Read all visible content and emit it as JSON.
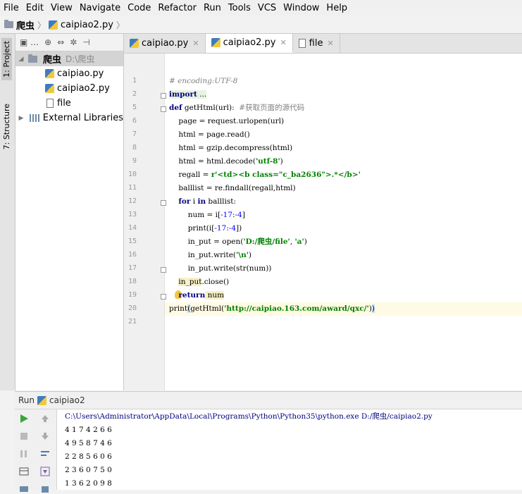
{
  "menu": [
    "File",
    "Edit",
    "View",
    "Navigate",
    "Code",
    "Refactor",
    "Run",
    "Tools",
    "VCS",
    "Window",
    "Help"
  ],
  "breadcrumb": {
    "project": "爬虫",
    "file": "caipiao2.py"
  },
  "side_tabs": {
    "project": "1: Project",
    "structure": "7: Structure"
  },
  "project_tree": {
    "root_name": "爬虫",
    "root_path": "D:\\爬虫",
    "files": [
      "caipiao.py",
      "caipiao2.py",
      "file"
    ],
    "libraries": "External Libraries"
  },
  "tabs": [
    "caipiao.py",
    "caipiao2.py",
    "file"
  ],
  "line_numbers": [
    "1",
    "2",
    "5",
    "6",
    "7",
    "8",
    "9",
    "10",
    "11",
    "12",
    "13",
    "14",
    "15",
    "16",
    "17",
    "18",
    "19",
    "20",
    "21"
  ],
  "code": {
    "l1": "# encoding:UTF-8",
    "l2_kw": "import",
    "l2_rest": " ...",
    "l5_kw": "def",
    "l5_rest": " getHtml(url):  ",
    "l5_comment": "#获取页面的源代码",
    "l6": "    page = request.urlopen(url)",
    "l7": "    html = page.read()",
    "l8": "    html = gzip.decompress(html)",
    "l9_pre": "    html = html.decode(",
    "l9_str": "'utf-8'",
    "l9_post": ")",
    "l10_pre": "    regall = ",
    "l10_str": "r'<td><b class=\"c_ba2636\">.*</b>'",
    "l11": "    balllist = re.findall(regall,html)",
    "l12_kw1": "for",
    "l12_mid": " i ",
    "l12_kw2": "in",
    "l12_rest": " balllist:",
    "l13_pre": "        num = i[",
    "l13_n1": "-17",
    "l13_mid": ":",
    "l13_n2": "-4",
    "l13_post": "]",
    "l14_pre": "        print(i[",
    "l14_n1": "-17",
    "l14_mid": ":",
    "l14_n2": "-4",
    "l14_post": "])",
    "l15_pre": "        in_put = open(",
    "l15_s1": "'D:/爬虫/file'",
    "l15_mid": ", ",
    "l15_s2": "'a'",
    "l15_post": ")",
    "l16_pre": "        in_put.write(",
    "l16_str": "'\\n'",
    "l16_post": ")",
    "l17": "        in_put.write(str(num))",
    "l18_hl": "in_put",
    "l18_rest": ".close()",
    "l19_kw": "return",
    "l19_rest": " num",
    "l20_pre": "print",
    "l20_p": "(",
    "l20_mid": "getHtml(",
    "l20_str": "'http://caipiao.163.com/award/qxc/'",
    "l20_end": ")",
    "l20_p2": ")"
  },
  "run": {
    "label": "Run",
    "config": "caipiao2",
    "command": "C:\\Users\\Administrator\\AppData\\Local\\Programs\\Python\\Python35\\python.exe D:/爬虫/caipiao2.py",
    "output": [
      "4 1 7 4 2 6 6",
      "4 9 5 8 7 4 6",
      "2 2 8 5 6 0 6",
      "2 3 6 0 7 5 0",
      "1 3 6 2 0 9 8"
    ]
  }
}
